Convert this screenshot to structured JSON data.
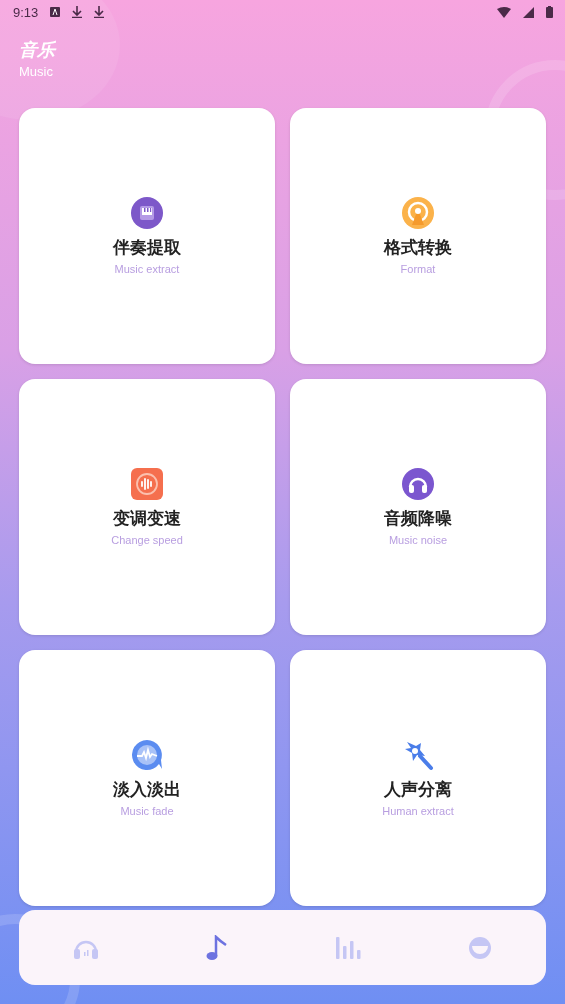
{
  "status_bar": {
    "time": "9:13"
  },
  "header": {
    "title": "音乐",
    "subtitle": "Music"
  },
  "tools": [
    {
      "kind": "piano",
      "title": "伴奏提取",
      "subtitle": "Music extract"
    },
    {
      "kind": "format",
      "title": "格式转换",
      "subtitle": "Format"
    },
    {
      "kind": "speed",
      "title": "变调变速",
      "subtitle": "Change speed"
    },
    {
      "kind": "noise",
      "title": "音频降噪",
      "subtitle": "Music noise"
    },
    {
      "kind": "fade",
      "title": "淡入淡出",
      "subtitle": "Music fade"
    },
    {
      "kind": "wand",
      "title": "人声分离",
      "subtitle": "Human extract"
    }
  ],
  "nav": [
    {
      "kind": "headphones",
      "selected": false
    },
    {
      "kind": "note",
      "selected": true
    },
    {
      "kind": "bars",
      "selected": false
    },
    {
      "kind": "face",
      "selected": false
    }
  ]
}
